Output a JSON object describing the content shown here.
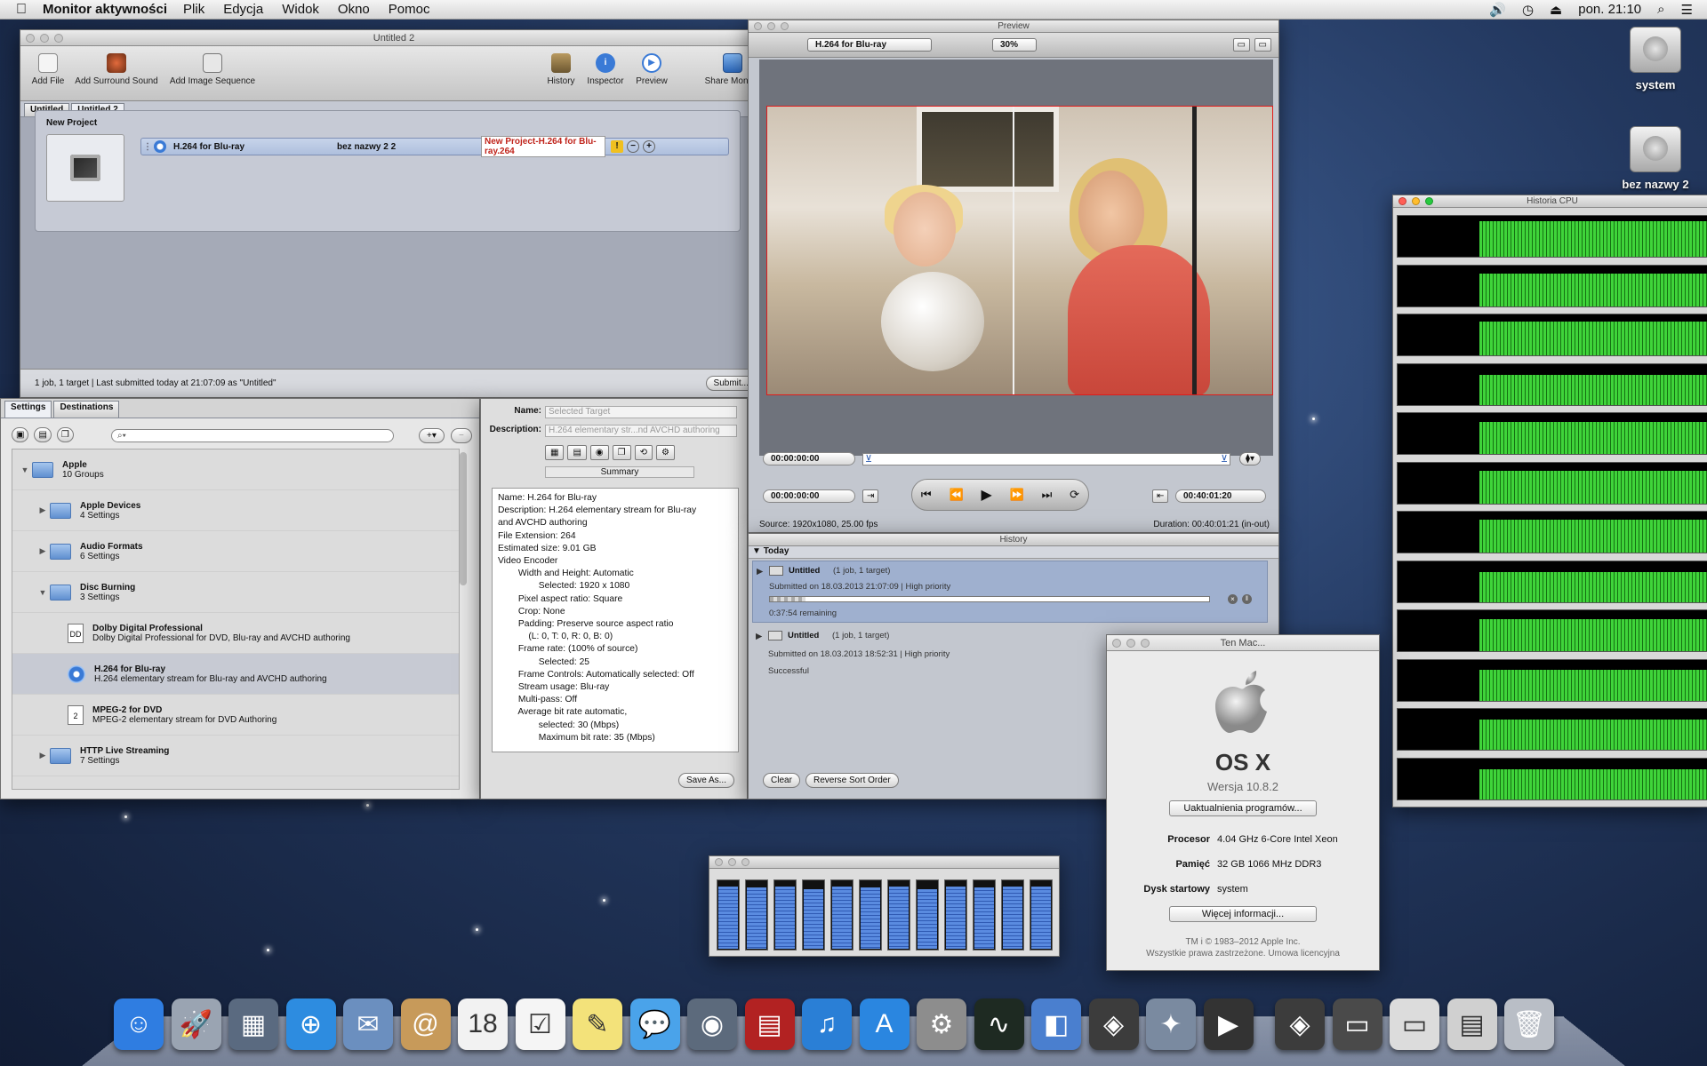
{
  "menubar": {
    "app_name": "Monitor aktywności",
    "items": [
      "Plik",
      "Edycja",
      "Widok",
      "Okno",
      "Pomoc"
    ],
    "clock": "pon. 21:10"
  },
  "compressor": {
    "title": "Untitled 2",
    "toolbar": {
      "add_file": "Add File",
      "add_surround": "Add Surround Sound",
      "add_image_seq": "Add Image Sequence",
      "history": "History",
      "inspector": "Inspector",
      "preview": "Preview",
      "share_monitor": "Share Monitor"
    },
    "tabs": [
      "Untitled",
      "Untitled 2"
    ],
    "batch_label": "New Project",
    "job": {
      "setting": "H.264 for Blu-ray",
      "destination": "bez nazwy 2 2",
      "output": "New Project-H.264 for Blu-ray.264"
    },
    "status": "1 job, 1 target   |   Last submitted today at 21:07:09 as \"Untitled\"",
    "submit": "Submit..."
  },
  "settings_panel": {
    "tabs": [
      "Settings",
      "Destinations"
    ],
    "rows": [
      {
        "name": "Apple",
        "detail": "10 Groups",
        "kind": "folder",
        "indent": 0,
        "expanded": true
      },
      {
        "name": "Apple Devices",
        "detail": "4 Settings",
        "kind": "folder",
        "indent": 1,
        "expanded": false
      },
      {
        "name": "Audio Formats",
        "detail": "6 Settings",
        "kind": "folder",
        "indent": 1,
        "expanded": false
      },
      {
        "name": "Disc Burning",
        "detail": "3 Settings",
        "kind": "folder",
        "indent": 1,
        "expanded": true
      },
      {
        "name": "Dolby Digital Professional",
        "detail": "Dolby Digital Professional for DVD, Blu-ray and AVCHD authoring",
        "kind": "doc",
        "indent": 2,
        "icon_text": "DD"
      },
      {
        "name": "H.264 for Blu-ray",
        "detail": "H.264 elementary stream for Blu-ray and AVCHD authoring",
        "kind": "disc",
        "indent": 2,
        "selected": true
      },
      {
        "name": "MPEG-2 for DVD",
        "detail": "MPEG-2 elementary stream for DVD Authoring",
        "kind": "doc",
        "indent": 2,
        "icon_text": "2"
      },
      {
        "name": "HTTP Live Streaming",
        "detail": "7 Settings",
        "kind": "folder",
        "indent": 1,
        "expanded": false
      }
    ]
  },
  "inspector": {
    "name_label": "Name:",
    "name_value": "Selected Target",
    "desc_label": "Description:",
    "desc_value": "H.264 elementary str...nd AVCHD authoring",
    "summary_tab": "Summary",
    "summary_lines": [
      "Name: H.264 for Blu-ray",
      "Description: H.264 elementary stream for Blu-ray",
      "and AVCHD authoring",
      "File Extension: 264",
      "Estimated size: 9.01 GB",
      "Video Encoder",
      "        Width and Height: Automatic",
      "                Selected: 1920 x 1080",
      "        Pixel aspect ratio: Square",
      "        Crop: None",
      "        Padding: Preserve source aspect ratio",
      "            (L: 0, T: 0, R: 0, B: 0)",
      "        Frame rate: (100% of source)",
      "                Selected: 25",
      "        Frame Controls: Automatically selected: Off",
      "        Stream usage: Blu-ray",
      "        Multi-pass: Off",
      "        Average bit rate automatic,",
      "                selected: 30 (Mbps)",
      "                Maximum bit rate: 35 (Mbps)"
    ],
    "save_as": "Save As..."
  },
  "preview": {
    "title": "Preview",
    "setting": "H.264 for Blu-ray",
    "zoom": "30%",
    "tc_in": "00:00:00:00",
    "tc_current": "00:00:00:00",
    "tc_duration": "00:40:01:20",
    "source": "Source: 1920x1080, 25.00 fps",
    "duration": "Duration: 00:40:01:21 (in-out)"
  },
  "history": {
    "title": "History",
    "group": "Today",
    "items": [
      {
        "name": "Untitled",
        "meta": "(1 job, 1 target)",
        "submitted": "Submitted on 18.03.2013 21:07:09  |  High priority",
        "status": "0:37:54 remaining",
        "progress": 0.08
      },
      {
        "name": "Untitled",
        "meta": "(1 job, 1 target)",
        "submitted": "Submitted on 18.03.2013 18:52:31  |  High priority",
        "status": "Successful"
      }
    ],
    "clear": "Clear",
    "reverse": "Reverse Sort Order"
  },
  "cpu": {
    "title": "Historia CPU",
    "cores": [
      0.88,
      0.8,
      0.82,
      0.72,
      0.78,
      0.8,
      0.8,
      0.72,
      0.78,
      0.74,
      0.74,
      0.72
    ]
  },
  "about": {
    "title": "Ten Mac...",
    "os": "OS X",
    "version": "Wersja 10.8.2",
    "update_button": "Uaktualnienia programów...",
    "processor_label": "Procesor",
    "processor": "4.04 GHz 6-Core Intel Xeon",
    "memory_label": "Pamięć",
    "memory": "32 GB 1066 MHz DDR3",
    "disk_label": "Dysk startowy",
    "disk": "system",
    "more_button": "Więcej informacji...",
    "copyright1": "TM i © 1983–2012 Apple Inc.",
    "copyright2": "Wszystkie prawa zastrzeżone.  Umowa licencyjna"
  },
  "meter": {
    "levels": [
      0.9,
      0.88,
      0.9,
      0.86,
      0.9,
      0.88,
      0.9,
      0.86,
      0.9,
      0.88,
      0.9,
      0.9
    ]
  },
  "desktop": {
    "disk1": "system",
    "disk2": "bez nazwy 2"
  },
  "dock": {
    "apps": [
      {
        "icon": "finder-icon",
        "glyph": "☺",
        "color": "#2f7de1"
      },
      {
        "icon": "launchpad-icon",
        "glyph": "🚀",
        "color": "#9aa4b2"
      },
      {
        "icon": "mission-control-icon",
        "glyph": "▦",
        "color": "#5a6a80"
      },
      {
        "icon": "safari-icon",
        "glyph": "⊕",
        "color": "#2d8ce0"
      },
      {
        "icon": "mail-icon",
        "glyph": "✉",
        "color": "#6b8fbf"
      },
      {
        "icon": "contacts-icon",
        "glyph": "@",
        "color": "#c79a5a"
      },
      {
        "icon": "calendar-icon",
        "glyph": "18",
        "color": "#f2f2f2"
      },
      {
        "icon": "reminders-icon",
        "glyph": "☑",
        "color": "#f5f5f5"
      },
      {
        "icon": "notes-icon",
        "glyph": "✎",
        "color": "#f3e27a"
      },
      {
        "icon": "messages-icon",
        "glyph": "💬",
        "color": "#4aa3ea"
      },
      {
        "icon": "facetime-icon",
        "glyph": "◉",
        "color": "#5c6a7c"
      },
      {
        "icon": "photo-booth-icon",
        "glyph": "▤",
        "color": "#b22222"
      },
      {
        "icon": "itunes-icon",
        "glyph": "♫",
        "color": "#2a7fd6"
      },
      {
        "icon": "app-store-icon",
        "glyph": "A",
        "color": "#2a86e0"
      },
      {
        "icon": "system-preferences-icon",
        "glyph": "⚙",
        "color": "#8d8d8d"
      },
      {
        "icon": "activity-monitor-icon",
        "glyph": "∿",
        "color": "#1e2a22"
      },
      {
        "icon": "keynote-icon",
        "glyph": "◧",
        "color": "#4a7fcf"
      },
      {
        "icon": "compressor-icon",
        "glyph": "◈",
        "color": "#3c3c3c"
      },
      {
        "icon": "motion-icon",
        "glyph": "✦",
        "color": "#7a8aa0"
      },
      {
        "icon": "final-cut-icon",
        "glyph": "▶",
        "color": "#333"
      },
      {
        "icon": "compressor-running-icon",
        "glyph": "◈",
        "color": "#3c3c3c"
      },
      {
        "icon": "preview-window-icon",
        "glyph": "▭",
        "color": "#4a4a4a"
      },
      {
        "icon": "timecode-window-icon",
        "glyph": "▭",
        "color": "#dcdcdc"
      },
      {
        "icon": "settings-window-icon",
        "glyph": "▤",
        "color": "#d0d0d0"
      },
      {
        "icon": "trash-icon",
        "glyph": "🗑",
        "color": "#b9bec6"
      }
    ]
  },
  "colors": {
    "accent": "#3a7ad6",
    "cpu_green": "#3fd43a",
    "error": "#e01b1b"
  }
}
